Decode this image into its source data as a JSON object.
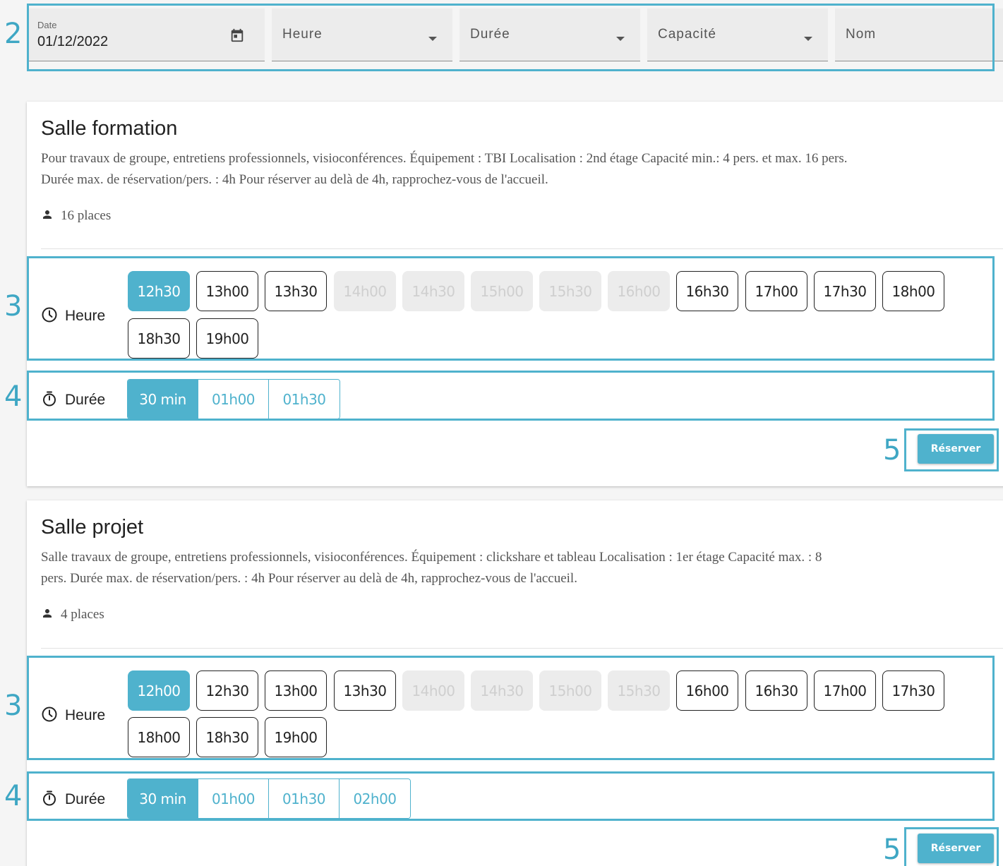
{
  "markers": {
    "filters": "2",
    "hours": "3",
    "durations": "4",
    "reserve": "5"
  },
  "filters": {
    "date": {
      "label": "Date",
      "value": "01/12/2022"
    },
    "heure": {
      "placeholder": "Heure"
    },
    "duree": {
      "placeholder": "Durée"
    },
    "capacite": {
      "placeholder": "Capacité"
    },
    "nom": {
      "placeholder": "Nom"
    }
  },
  "rooms": [
    {
      "title": "Salle formation",
      "description_line1": "Pour travaux de groupe, entretiens professionnels, visioconférences. Équipement : TBI Localisation : 2nd étage Capacité min.: 4 pers. et max. 16 pers.",
      "description_line2": "Durée max. de réservation/pers. : 4h Pour réserver au delà de 4h, rapprochez-vous de l'accueil.",
      "places": "16 places",
      "hour_label": "Heure",
      "duration_label": "Durée",
      "slots": [
        {
          "label": "12h30",
          "state": "selected"
        },
        {
          "label": "13h00",
          "state": "available"
        },
        {
          "label": "13h30",
          "state": "available"
        },
        {
          "label": "14h00",
          "state": "disabled"
        },
        {
          "label": "14h30",
          "state": "disabled"
        },
        {
          "label": "15h00",
          "state": "disabled"
        },
        {
          "label": "15h30",
          "state": "disabled"
        },
        {
          "label": "16h00",
          "state": "disabled"
        },
        {
          "label": "16h30",
          "state": "available"
        },
        {
          "label": "17h00",
          "state": "available"
        },
        {
          "label": "17h30",
          "state": "available"
        },
        {
          "label": "18h00",
          "state": "available"
        },
        {
          "label": "18h30",
          "state": "available"
        },
        {
          "label": "19h00",
          "state": "available"
        }
      ],
      "durations": [
        {
          "label": "30 min",
          "selected": true
        },
        {
          "label": "01h00",
          "selected": false
        },
        {
          "label": "01h30",
          "selected": false
        }
      ],
      "reserve_label": "Réserver"
    },
    {
      "title": "Salle projet",
      "description_line1": "Salle travaux de groupe, entretiens professionnels, visioconférences. Équipement : clickshare et tableau Localisation : 1er étage Capacité max. : 8",
      "description_line2": "pers. Durée max. de réservation/pers. : 4h Pour réserver au delà de 4h, rapprochez-vous de l'accueil.",
      "places": "4 places",
      "hour_label": "Heure",
      "duration_label": "Durée",
      "slots": [
        {
          "label": "12h00",
          "state": "selected"
        },
        {
          "label": "12h30",
          "state": "available"
        },
        {
          "label": "13h00",
          "state": "available"
        },
        {
          "label": "13h30",
          "state": "available"
        },
        {
          "label": "14h00",
          "state": "disabled"
        },
        {
          "label": "14h30",
          "state": "disabled"
        },
        {
          "label": "15h00",
          "state": "disabled"
        },
        {
          "label": "15h30",
          "state": "disabled"
        },
        {
          "label": "16h00",
          "state": "available"
        },
        {
          "label": "16h30",
          "state": "available"
        },
        {
          "label": "17h00",
          "state": "available"
        },
        {
          "label": "17h30",
          "state": "available"
        },
        {
          "label": "18h00",
          "state": "available"
        },
        {
          "label": "18h30",
          "state": "available"
        },
        {
          "label": "19h00",
          "state": "available"
        }
      ],
      "durations": [
        {
          "label": "30 min",
          "selected": true
        },
        {
          "label": "01h00",
          "selected": false
        },
        {
          "label": "01h30",
          "selected": false
        },
        {
          "label": "02h00",
          "selected": false
        }
      ],
      "reserve_label": "Réserver"
    }
  ]
}
